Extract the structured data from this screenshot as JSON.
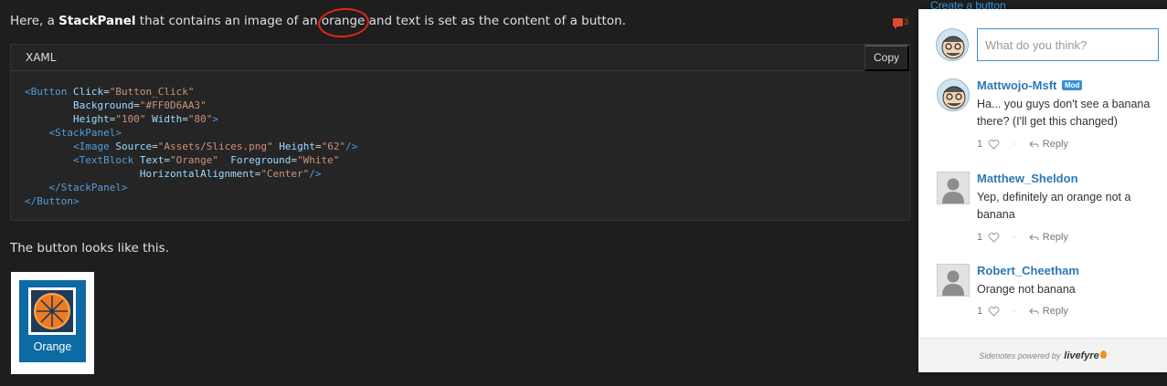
{
  "intro": {
    "prefix": "Here, a ",
    "bold": "StackPanel",
    "middle": " that contains an image of an ",
    "circled_word": "orange",
    "suffix": " and text is set as the content of a button."
  },
  "comment_marker": {
    "count": "3",
    "icon": "comment-bubble-icon",
    "color": "#e24a2e"
  },
  "code": {
    "language": "XAML",
    "copy_label": "Copy"
  },
  "caption": "The button looks like this.",
  "preview_button": {
    "label": "Orange",
    "background": "#0d6aa3"
  },
  "sidenotes": {
    "create_link": "Create a button",
    "input_placeholder": "What do you think?",
    "comments": [
      {
        "author": "Mattwojo-Msft",
        "badge": "Mod",
        "body": "Ha... you guys don't see a banana there? (I'll get this changed)",
        "likes": "1",
        "reply_label": "Reply",
        "avatar": "cartoon-avatar"
      },
      {
        "author": "Matthew_Sheldon",
        "body": "Yep, definitely an orange not a banana",
        "likes": "1",
        "reply_label": "Reply",
        "avatar": "default-avatar"
      },
      {
        "author": "Robert_Cheetham",
        "body": "Orange not banana",
        "likes": "1",
        "reply_label": "Reply",
        "avatar": "default-avatar"
      }
    ],
    "footer_text": "Sidenotes powered by",
    "footer_brand": "livefyre"
  },
  "colors": {
    "accent": "#3b8fd1",
    "author": "#2e78b5",
    "page_bg": "#1e1e1e",
    "code_bg": "#252526"
  }
}
